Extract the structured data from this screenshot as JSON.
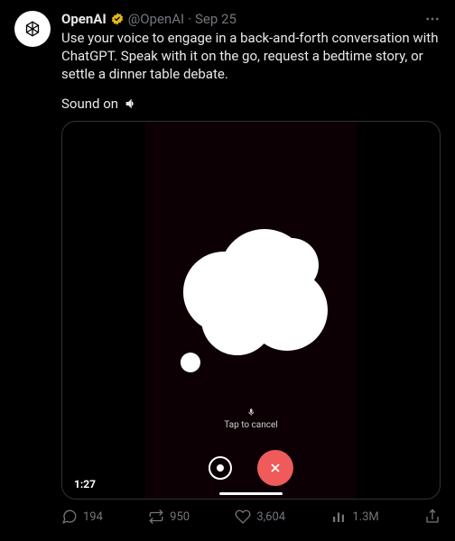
{
  "author": {
    "name": "OpenAI",
    "handle": "@OpenAI",
    "date": "Sep 25",
    "separator": "·"
  },
  "tweet": {
    "text": "Use your voice to engage in a back-and-forth conversation with ChatGPT. Speak with it on the go, request a bedtime story, or settle a dinner table debate.",
    "sound_label": "Sound on"
  },
  "video": {
    "tap_to_cancel": "Tap to cancel",
    "timestamp": "1:27"
  },
  "metrics": {
    "replies": "194",
    "reposts": "950",
    "likes": "3,604",
    "views": "1.3M"
  }
}
